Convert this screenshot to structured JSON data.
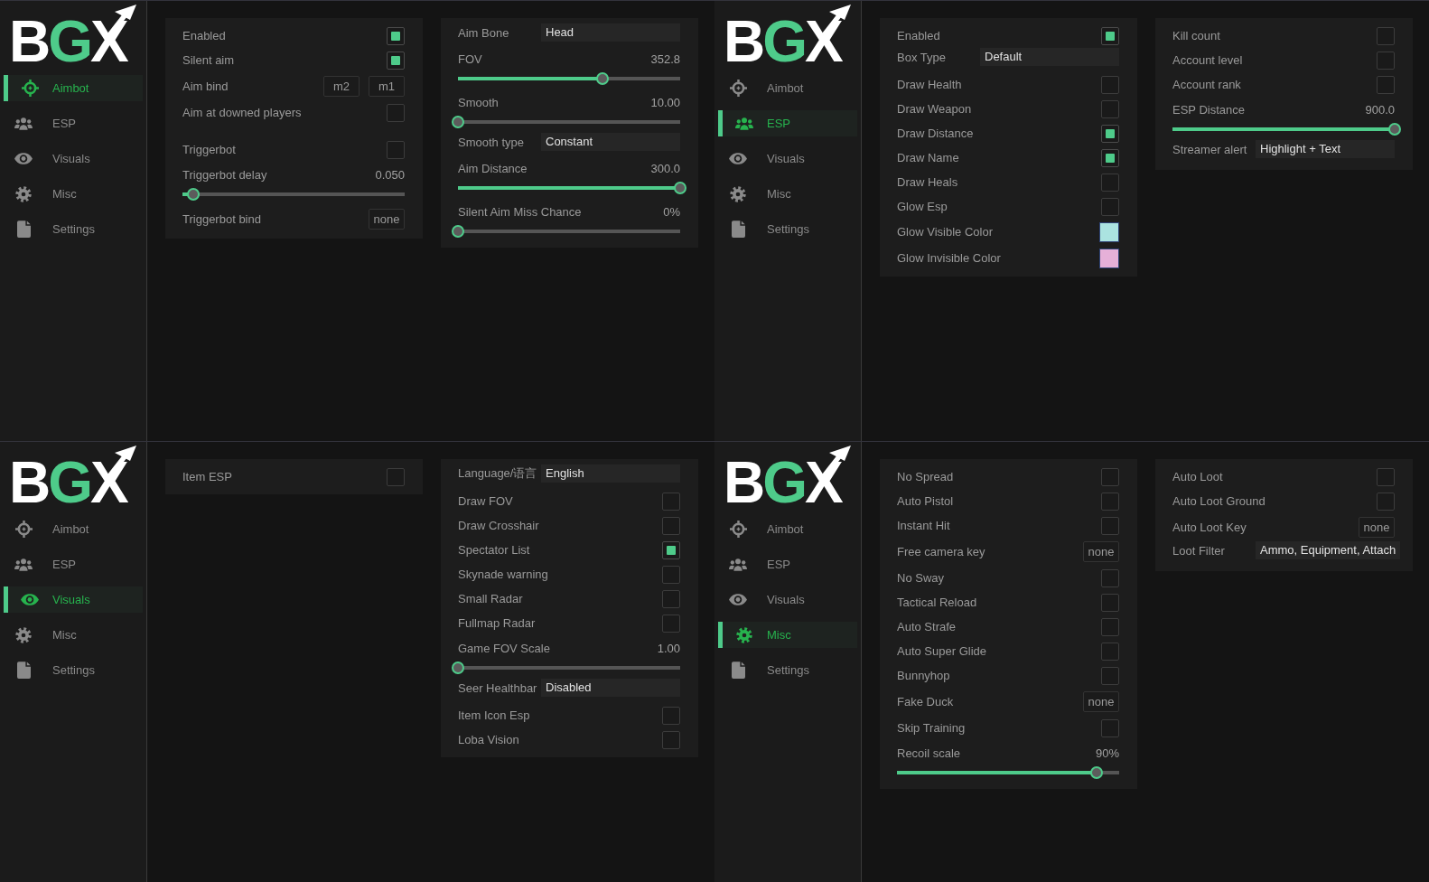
{
  "windows": [
    {
      "logo": "BGX",
      "nav": [
        {
          "label": "Aimbot",
          "selected": true
        },
        {
          "label": "ESP",
          "selected": false
        },
        {
          "label": "Visuals",
          "selected": false
        },
        {
          "label": "Misc",
          "selected": false
        },
        {
          "label": "Settings",
          "selected": false
        }
      ],
      "panels": [
        {
          "groups": [
            {
              "items": [
                {
                  "kind": "checkbox",
                  "label": "Enabled",
                  "checked": true
                },
                {
                  "kind": "checkbox",
                  "label": "Silent aim",
                  "checked": true
                },
                {
                  "kind": "keybind",
                  "label": "Aim bind",
                  "keys": [
                    "m2",
                    "m1"
                  ]
                },
                {
                  "kind": "checkbox",
                  "label": "Aim at downed players",
                  "checked": false
                }
              ]
            },
            {
              "items": [
                {
                  "kind": "checkbox",
                  "label": "Triggerbot",
                  "checked": false
                },
                {
                  "kind": "slider",
                  "label": "Triggerbot delay",
                  "reading": "0.050",
                  "level": 0.05
                },
                {
                  "kind": "keybind",
                  "label": "Triggerbot bind",
                  "keys": [
                    "none"
                  ]
                }
              ]
            }
          ]
        },
        {
          "groups": [
            {
              "items": [
                {
                  "kind": "select",
                  "label": "Aim Bone",
                  "value": "Head"
                },
                {
                  "kind": "slider",
                  "label": "FOV",
                  "reading": "352.8",
                  "level": 0.65
                },
                {
                  "kind": "slider",
                  "label": "Smooth",
                  "reading": "10.00",
                  "level": 0
                },
                {
                  "kind": "select",
                  "label": "Smooth type",
                  "value": "Constant"
                },
                {
                  "kind": "slider",
                  "label": "Aim Distance",
                  "reading": "300.0",
                  "level": 1
                },
                {
                  "kind": "slider",
                  "label": "Silent Aim Miss Chance",
                  "reading": "0%",
                  "level": 0
                }
              ]
            }
          ]
        }
      ]
    },
    {
      "logo": "BGX",
      "nav": [
        {
          "label": "Aimbot",
          "selected": false
        },
        {
          "label": "ESP",
          "selected": true
        },
        {
          "label": "Visuals",
          "selected": false
        },
        {
          "label": "Misc",
          "selected": false
        },
        {
          "label": "Settings",
          "selected": false
        }
      ],
      "panels": [
        {
          "groups": [
            {
              "items": [
                {
                  "kind": "checkbox",
                  "label": "Enabled",
                  "checked": true
                },
                {
                  "kind": "select",
                  "label": "Box Type",
                  "value": "Default"
                },
                {
                  "kind": "checkbox",
                  "label": "Draw Health",
                  "checked": false
                },
                {
                  "kind": "checkbox",
                  "label": "Draw Weapon",
                  "checked": false
                },
                {
                  "kind": "checkbox",
                  "label": "Draw Distance",
                  "checked": true
                },
                {
                  "kind": "checkbox",
                  "label": "Draw Name",
                  "checked": true
                },
                {
                  "kind": "checkbox",
                  "label": "Draw Heals",
                  "checked": false
                },
                {
                  "kind": "checkbox",
                  "label": "Glow Esp",
                  "checked": false
                },
                {
                  "kind": "color",
                  "label": "Glow Visible Color",
                  "color": "#abe3e0"
                },
                {
                  "kind": "color",
                  "label": "Glow Invisible Color",
                  "color": "#e6b0d8"
                }
              ]
            }
          ]
        },
        {
          "groups": [
            {
              "items": [
                {
                  "kind": "checkbox",
                  "label": "Kill count",
                  "checked": false
                },
                {
                  "kind": "checkbox",
                  "label": "Account level",
                  "checked": false
                },
                {
                  "kind": "checkbox",
                  "label": "Account rank",
                  "checked": false
                },
                {
                  "kind": "slider",
                  "label": "ESP Distance",
                  "reading": "900.0",
                  "level": 1
                },
                {
                  "kind": "select",
                  "label": "Streamer alert",
                  "value": "Highlight + Text"
                }
              ]
            }
          ]
        }
      ]
    },
    {
      "logo": "BGX",
      "nav": [
        {
          "label": "Aimbot",
          "selected": false
        },
        {
          "label": "ESP",
          "selected": false
        },
        {
          "label": "Visuals",
          "selected": true
        },
        {
          "label": "Misc",
          "selected": false
        },
        {
          "label": "Settings",
          "selected": false
        }
      ],
      "panels": [
        {
          "groups": [
            {
              "items": [
                {
                  "kind": "checkbox",
                  "label": "Item ESP",
                  "checked": false
                }
              ]
            }
          ]
        },
        {
          "groups": [
            {
              "items": [
                {
                  "kind": "select",
                  "label": "Language/语言",
                  "value": "English"
                },
                {
                  "kind": "checkbox",
                  "label": "Draw FOV",
                  "checked": false
                },
                {
                  "kind": "checkbox",
                  "label": "Draw Crosshair",
                  "checked": false
                },
                {
                  "kind": "checkbox",
                  "label": "Spectator List",
                  "checked": true
                },
                {
                  "kind": "checkbox",
                  "label": "Skynade warning",
                  "checked": false
                },
                {
                  "kind": "checkbox",
                  "label": "Small Radar",
                  "checked": false
                },
                {
                  "kind": "checkbox",
                  "label": "Fullmap Radar",
                  "checked": false
                },
                {
                  "kind": "slider",
                  "label": "Game FOV Scale",
                  "reading": "1.00",
                  "level": 0
                },
                {
                  "kind": "select",
                  "label": "Seer Healthbar",
                  "value": "Disabled"
                },
                {
                  "kind": "checkbox",
                  "label": "Item Icon Esp",
                  "checked": false
                },
                {
                  "kind": "checkbox",
                  "label": "Loba Vision",
                  "checked": false
                }
              ]
            }
          ]
        }
      ]
    },
    {
      "logo": "BGX",
      "nav": [
        {
          "label": "Aimbot",
          "selected": false
        },
        {
          "label": "ESP",
          "selected": false
        },
        {
          "label": "Visuals",
          "selected": false
        },
        {
          "label": "Misc",
          "selected": true
        },
        {
          "label": "Settings",
          "selected": false
        }
      ],
      "panels": [
        {
          "groups": [
            {
              "items": [
                {
                  "kind": "checkbox",
                  "label": "No Spread",
                  "checked": false
                },
                {
                  "kind": "checkbox",
                  "label": "Auto Pistol",
                  "checked": false
                },
                {
                  "kind": "checkbox",
                  "label": "Instant Hit",
                  "checked": false
                },
                {
                  "kind": "keybind",
                  "label": "Free camera key",
                  "keys": [
                    "none"
                  ]
                },
                {
                  "kind": "checkbox",
                  "label": "No Sway",
                  "checked": false
                },
                {
                  "kind": "checkbox",
                  "label": "Tactical Reload",
                  "checked": false
                },
                {
                  "kind": "checkbox",
                  "label": "Auto Strafe",
                  "checked": false
                },
                {
                  "kind": "checkbox",
                  "label": "Auto Super Glide",
                  "checked": false
                },
                {
                  "kind": "checkbox",
                  "label": "Bunnyhop",
                  "checked": false
                },
                {
                  "kind": "keybind",
                  "label": "Fake Duck",
                  "keys": [
                    "none"
                  ]
                },
                {
                  "kind": "checkbox",
                  "label": "Skip Training",
                  "checked": false
                },
                {
                  "kind": "slider",
                  "label": "Recoil scale",
                  "reading": "90%",
                  "level": 0.9
                }
              ]
            }
          ]
        },
        {
          "groups": [
            {
              "items": [
                {
                  "kind": "checkbox",
                  "label": "Auto Loot",
                  "checked": false
                },
                {
                  "kind": "checkbox",
                  "label": "Auto Loot Ground",
                  "checked": false
                },
                {
                  "kind": "keybind",
                  "label": "Auto Loot Key",
                  "keys": [
                    "none"
                  ]
                },
                {
                  "kind": "select",
                  "label": "Loot Filter",
                  "value": "Ammo, Equipment, Attach"
                }
              ]
            }
          ]
        }
      ]
    }
  ]
}
